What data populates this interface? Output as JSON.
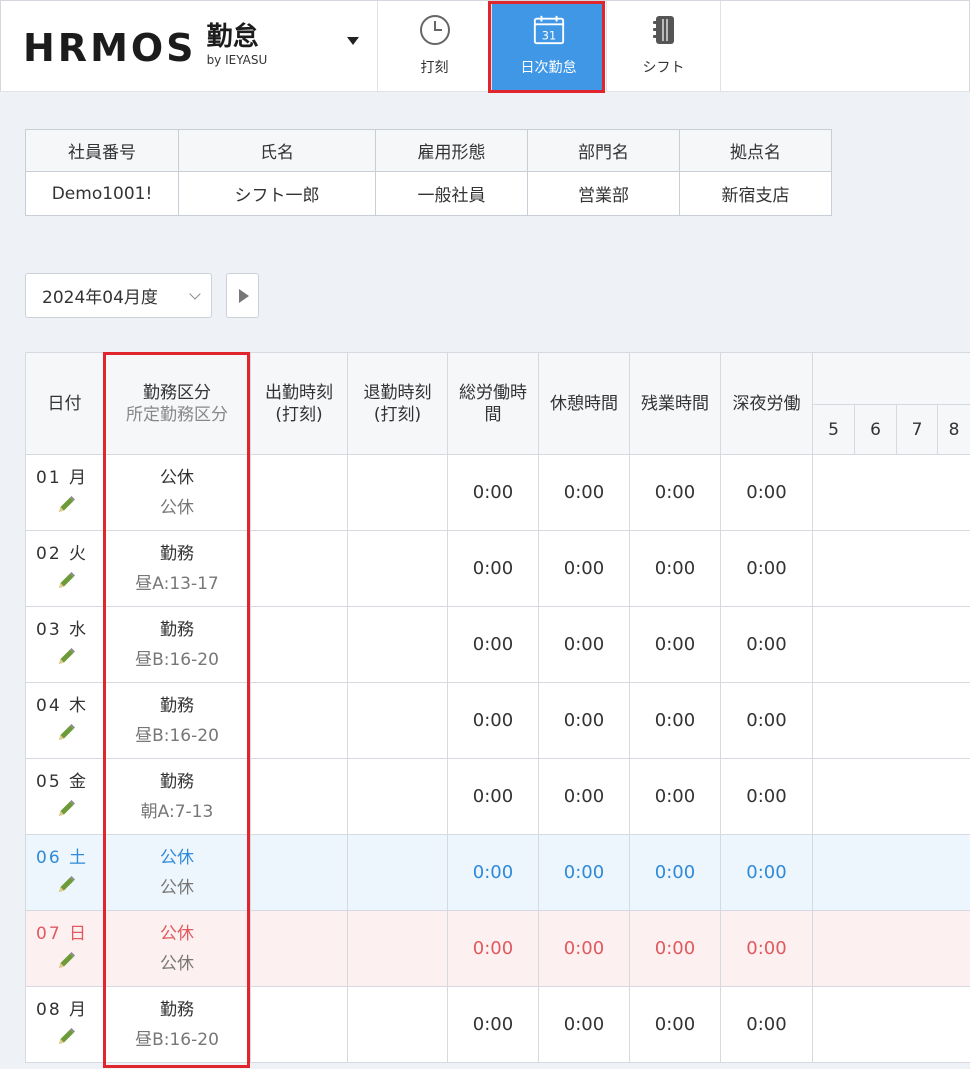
{
  "header": {
    "logo": "HRMOS",
    "product": "勤怠",
    "by": "by IEYASU",
    "nav": [
      {
        "label": "打刻",
        "icon": "clock-icon"
      },
      {
        "label": "日次勤怠",
        "icon": "calendar-icon",
        "calendar_day": "31",
        "active": true
      },
      {
        "label": "シフト",
        "icon": "notebook-icon"
      }
    ]
  },
  "employee": {
    "headers": [
      "社員番号",
      "氏名",
      "雇用形態",
      "部門名",
      "拠点名"
    ],
    "values": [
      "Demo1001!",
      "シフト一郎",
      "一般社員",
      "営業部",
      "新宿支店"
    ]
  },
  "month_selector": {
    "value": "2024年04月度"
  },
  "table": {
    "headers": {
      "date": "日付",
      "kubun": "勤務区分",
      "kubun_sub": "所定勤務区分",
      "clock_in": "出勤時刻",
      "clock_in_sub": "(打刻)",
      "clock_out": "退勤時刻",
      "clock_out_sub": "(打刻)",
      "total": "総労働時間",
      "rest": "休憩時間",
      "overtime": "残業時間",
      "night": "深夜労働",
      "hours": [
        "5",
        "6",
        "7",
        "8"
      ]
    },
    "rows": [
      {
        "day": "01",
        "dow": "月",
        "kubun": "公休",
        "scheduled": "公休",
        "total": "0:00",
        "rest": "0:00",
        "overtime": "0:00",
        "night": "0:00",
        "type": "weekday"
      },
      {
        "day": "02",
        "dow": "火",
        "kubun": "勤務",
        "scheduled": "昼A:13-17",
        "total": "0:00",
        "rest": "0:00",
        "overtime": "0:00",
        "night": "0:00",
        "type": "weekday"
      },
      {
        "day": "03",
        "dow": "水",
        "kubun": "勤務",
        "scheduled": "昼B:16-20",
        "total": "0:00",
        "rest": "0:00",
        "overtime": "0:00",
        "night": "0:00",
        "type": "weekday"
      },
      {
        "day": "04",
        "dow": "木",
        "kubun": "勤務",
        "scheduled": "昼B:16-20",
        "total": "0:00",
        "rest": "0:00",
        "overtime": "0:00",
        "night": "0:00",
        "type": "weekday"
      },
      {
        "day": "05",
        "dow": "金",
        "kubun": "勤務",
        "scheduled": "朝A:7-13",
        "total": "0:00",
        "rest": "0:00",
        "overtime": "0:00",
        "night": "0:00",
        "type": "weekday"
      },
      {
        "day": "06",
        "dow": "土",
        "kubun": "公休",
        "scheduled": "公休",
        "total": "0:00",
        "rest": "0:00",
        "overtime": "0:00",
        "night": "0:00",
        "type": "sat"
      },
      {
        "day": "07",
        "dow": "日",
        "kubun": "公休",
        "scheduled": "公休",
        "total": "0:00",
        "rest": "0:00",
        "overtime": "0:00",
        "night": "0:00",
        "type": "sun"
      },
      {
        "day": "08",
        "dow": "月",
        "kubun": "勤務",
        "scheduled": "昼B:16-20",
        "total": "0:00",
        "rest": "0:00",
        "overtime": "0:00",
        "night": "0:00",
        "type": "weekday"
      }
    ]
  },
  "colors": {
    "accent": "#3f97e6",
    "highlight": "#e0252c",
    "saturday": "#2f8ad8",
    "sunday": "#e05a5f"
  }
}
